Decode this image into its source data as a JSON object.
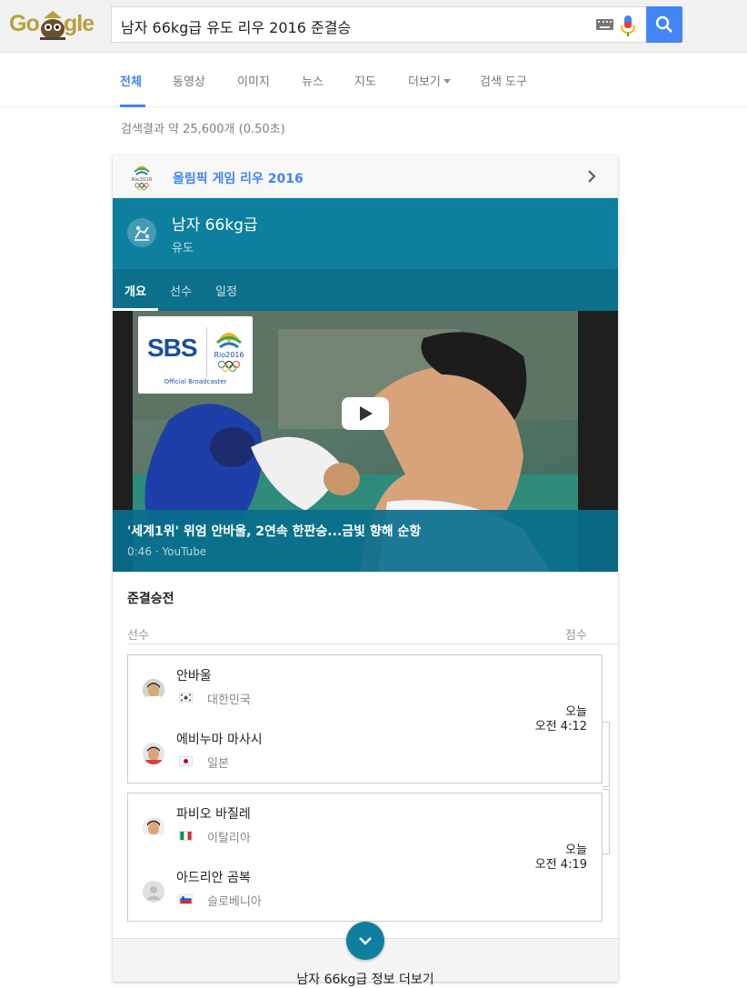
{
  "header": {
    "logo_text": "Go gle",
    "query": "남자 66kg급 유도 리우 2016 준결승"
  },
  "tabs": [
    {
      "label": "전체",
      "active": true
    },
    {
      "label": "동영상"
    },
    {
      "label": "이미지"
    },
    {
      "label": "뉴스"
    },
    {
      "label": "지도"
    },
    {
      "label": "더보기"
    },
    {
      "label": "검색 도구"
    }
  ],
  "result_stats": "검색결과 약 25,600개 (0.50초)",
  "card": {
    "olympics_title": "올림픽 게임 리우 2016",
    "event_title": "남자 66kg급",
    "event_sport": "유도",
    "tabs": [
      "개요",
      "선수",
      "일정"
    ],
    "video": {
      "broadcaster": "SBS",
      "broadcaster_note": "Official Broadcaster",
      "title": "'세계1위' 위엄 안바울, 2연속 한판승...금빛 향해 순항",
      "meta": "0:46 · YouTube"
    },
    "semifinal_title": "준결승전",
    "col_player": "선수",
    "col_score": "점수",
    "matches": [
      {
        "p1": {
          "name": "안바울",
          "country": "대한민국"
        },
        "p2": {
          "name": "에비누마 마사시",
          "country": "일본"
        },
        "time_day": "오늘",
        "time": "오전 4:12"
      },
      {
        "p1": {
          "name": "파비오 바질레",
          "country": "이탈리아"
        },
        "p2": {
          "name": "아드리안 곰복",
          "country": "슬로베니아"
        },
        "time_day": "오늘",
        "time": "오전 4:19"
      }
    ],
    "more_label": "남자 66kg급 정보 더보기"
  },
  "colors": {
    "google_blue": "#4285f4",
    "card_teal": "#0f7f9f",
    "card_teal_dark": "#0c6f8c"
  }
}
